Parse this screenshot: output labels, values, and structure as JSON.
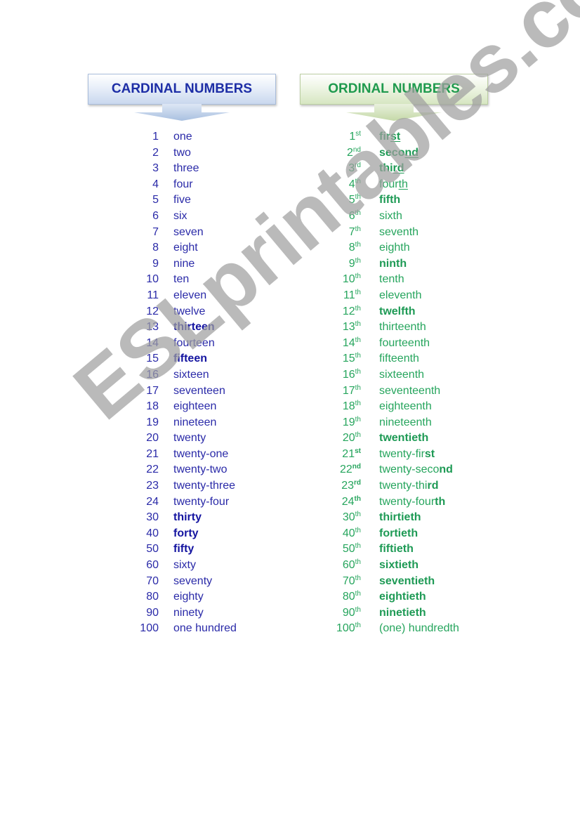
{
  "headers": {
    "cardinal": "CARDINAL NUMBERS",
    "ordinal": "ORDINAL NUMBERS"
  },
  "colors": {
    "cardinal_text": "#2a2aa8",
    "ordinal_text": "#26a55d",
    "watermark": "#a0a0a0"
  },
  "cardinal": [
    {
      "num": "1",
      "word": "one",
      "bold": false
    },
    {
      "num": "2",
      "word": "two",
      "bold": false
    },
    {
      "num": "3",
      "word": "three",
      "bold": false
    },
    {
      "num": "4",
      "word": "four",
      "bold": false
    },
    {
      "num": "5",
      "word": "five",
      "bold": false
    },
    {
      "num": "6",
      "word": "six",
      "bold": false
    },
    {
      "num": "7",
      "word": "seven",
      "bold": false
    },
    {
      "num": "8",
      "word": "eight",
      "bold": false
    },
    {
      "num": "9",
      "word": "nine",
      "bold": false
    },
    {
      "num": "10",
      "word": "ten",
      "bold": false
    },
    {
      "num": "11",
      "word": "eleven",
      "bold": false
    },
    {
      "num": "12",
      "word": "twelve",
      "bold": false
    },
    {
      "num": "13",
      "word": "thirteen",
      "bold": true
    },
    {
      "num": "14",
      "word": "fourteen",
      "bold": false
    },
    {
      "num": "15",
      "word": "fifteen",
      "bold": true
    },
    {
      "num": "16",
      "word": "sixteen",
      "bold": false
    },
    {
      "num": "17",
      "word": "seventeen",
      "bold": false
    },
    {
      "num": "18",
      "word": "eighteen",
      "bold": false
    },
    {
      "num": "19",
      "word": "nineteen",
      "bold": false
    },
    {
      "num": "20",
      "word": "twenty",
      "bold": false
    },
    {
      "num": "21",
      "word": "twenty-one",
      "bold": false
    },
    {
      "num": "22",
      "word": "twenty-two",
      "bold": false
    },
    {
      "num": "23",
      "word": "twenty-three",
      "bold": false
    },
    {
      "num": "24",
      "word": "twenty-four",
      "bold": false
    },
    {
      "num": "30",
      "word": "thirty",
      "bold": true
    },
    {
      "num": "40",
      "word": "forty",
      "bold": true
    },
    {
      "num": "50",
      "word": "fifty",
      "bold": true
    },
    {
      "num": "60",
      "word": "sixty",
      "bold": false
    },
    {
      "num": "70",
      "word": "seventy",
      "bold": false
    },
    {
      "num": "80",
      "word": "eighty",
      "bold": false
    },
    {
      "num": "90",
      "word": "ninety",
      "bold": false
    },
    {
      "num": "100",
      "word": "one hundred",
      "bold": false
    }
  ],
  "ordinal": [
    {
      "num": "1",
      "suffix": "st",
      "suffix_bold": false,
      "parts": [
        {
          "t": "fir",
          "s": "bold"
        },
        {
          "t": "st",
          "s": "bold-underline"
        }
      ]
    },
    {
      "num": "2",
      "suffix": "nd",
      "suffix_bold": false,
      "parts": [
        {
          "t": "seco",
          "s": "bold"
        },
        {
          "t": "nd",
          "s": "bold-underline"
        }
      ]
    },
    {
      "num": "3",
      "suffix": "rd",
      "suffix_bold": false,
      "parts": [
        {
          "t": "thi",
          "s": "bold"
        },
        {
          "t": "rd",
          "s": "bold-underline"
        }
      ]
    },
    {
      "num": "4",
      "suffix": "th",
      "suffix_bold": false,
      "parts": [
        {
          "t": "four",
          "s": "normal"
        },
        {
          "t": "th",
          "s": "underline"
        }
      ]
    },
    {
      "num": "5",
      "suffix": "th",
      "suffix_bold": false,
      "parts": [
        {
          "t": "fifth",
          "s": "bold"
        }
      ]
    },
    {
      "num": "6",
      "suffix": "th",
      "suffix_bold": false,
      "parts": [
        {
          "t": "sixth",
          "s": "normal"
        }
      ]
    },
    {
      "num": "7",
      "suffix": "th",
      "suffix_bold": false,
      "parts": [
        {
          "t": "seventh",
          "s": "normal"
        }
      ]
    },
    {
      "num": "8",
      "suffix": "th",
      "suffix_bold": false,
      "parts": [
        {
          "t": "eighth",
          "s": "normal"
        }
      ]
    },
    {
      "num": "9",
      "suffix": "th",
      "suffix_bold": false,
      "parts": [
        {
          "t": "ninth",
          "s": "bold"
        }
      ]
    },
    {
      "num": "10",
      "suffix": "th",
      "suffix_bold": false,
      "parts": [
        {
          "t": "tenth",
          "s": "normal"
        }
      ]
    },
    {
      "num": "11",
      "suffix": "th",
      "suffix_bold": false,
      "parts": [
        {
          "t": "eleventh",
          "s": "normal"
        }
      ]
    },
    {
      "num": "12",
      "suffix": "th",
      "suffix_bold": false,
      "parts": [
        {
          "t": "twelfth",
          "s": "bold"
        }
      ]
    },
    {
      "num": "13",
      "suffix": "th",
      "suffix_bold": false,
      "parts": [
        {
          "t": "thirteenth",
          "s": "normal"
        }
      ]
    },
    {
      "num": "14",
      "suffix": "th",
      "suffix_bold": false,
      "parts": [
        {
          "t": "fourteenth",
          "s": "normal"
        }
      ]
    },
    {
      "num": "15",
      "suffix": "th",
      "suffix_bold": false,
      "parts": [
        {
          "t": "fifteenth",
          "s": "normal"
        }
      ]
    },
    {
      "num": "16",
      "suffix": "th",
      "suffix_bold": false,
      "parts": [
        {
          "t": "sixteenth",
          "s": "normal"
        }
      ]
    },
    {
      "num": "17",
      "suffix": "th",
      "suffix_bold": false,
      "parts": [
        {
          "t": "seventeenth",
          "s": "normal"
        }
      ]
    },
    {
      "num": "18",
      "suffix": "th",
      "suffix_bold": false,
      "parts": [
        {
          "t": "eighteenth",
          "s": "normal"
        }
      ]
    },
    {
      "num": "19",
      "suffix": "th",
      "suffix_bold": false,
      "parts": [
        {
          "t": "nineteenth",
          "s": "normal"
        }
      ]
    },
    {
      "num": "20",
      "suffix": "th",
      "suffix_bold": false,
      "parts": [
        {
          "t": "twentieth",
          "s": "bold"
        }
      ]
    },
    {
      "num": "21",
      "suffix": "st",
      "suffix_bold": true,
      "parts": [
        {
          "t": "twenty-fir",
          "s": "normal"
        },
        {
          "t": "st",
          "s": "bold"
        }
      ]
    },
    {
      "num": "22",
      "suffix": "nd",
      "suffix_bold": true,
      "parts": [
        {
          "t": "twenty-seco",
          "s": "normal"
        },
        {
          "t": "nd",
          "s": "bold"
        }
      ]
    },
    {
      "num": "23",
      "suffix": "rd",
      "suffix_bold": true,
      "parts": [
        {
          "t": "twenty-thi",
          "s": "normal"
        },
        {
          "t": "rd",
          "s": "bold"
        }
      ]
    },
    {
      "num": "24",
      "suffix": "th",
      "suffix_bold": true,
      "parts": [
        {
          "t": "twenty-four",
          "s": "normal"
        },
        {
          "t": "th",
          "s": "bold"
        }
      ]
    },
    {
      "num": "30",
      "suffix": "th",
      "suffix_bold": false,
      "parts": [
        {
          "t": "thirtieth",
          "s": "bold"
        }
      ]
    },
    {
      "num": "40",
      "suffix": "th",
      "suffix_bold": false,
      "parts": [
        {
          "t": "fortieth",
          "s": "bold"
        }
      ]
    },
    {
      "num": "50",
      "suffix": "th",
      "suffix_bold": false,
      "parts": [
        {
          "t": "fiftieth",
          "s": "bold"
        }
      ]
    },
    {
      "num": "60",
      "suffix": "th",
      "suffix_bold": false,
      "parts": [
        {
          "t": "sixtieth",
          "s": "bold"
        }
      ]
    },
    {
      "num": "70",
      "suffix": "th",
      "suffix_bold": false,
      "parts": [
        {
          "t": "seventieth",
          "s": "bold"
        }
      ]
    },
    {
      "num": "80",
      "suffix": "th",
      "suffix_bold": false,
      "parts": [
        {
          "t": "eightieth",
          "s": "bold"
        }
      ]
    },
    {
      "num": "90",
      "suffix": "th",
      "suffix_bold": false,
      "parts": [
        {
          "t": "ninetieth",
          "s": "bold"
        }
      ]
    },
    {
      "num": "100",
      "suffix": "th",
      "suffix_bold": false,
      "parts": [
        {
          "t": "(one) hundredth",
          "s": "normal"
        }
      ]
    }
  ],
  "watermark": "ESLprintables.com"
}
